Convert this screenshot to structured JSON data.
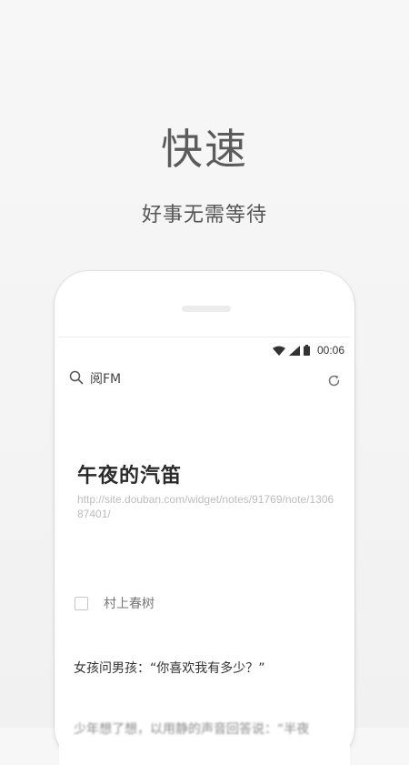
{
  "promo": {
    "headline": "快速",
    "subhead": "好事无需等待"
  },
  "phone": {
    "status_bar": {
      "time": "00:06",
      "icons": [
        "wifi-icon",
        "signal-icon",
        "battery-icon"
      ]
    },
    "search_bar": {
      "text": "阅FM",
      "left_icon": "search-icon",
      "right_icon": "refresh-icon"
    },
    "article": {
      "title": "午夜的汽笛",
      "url": "http://site.douban.com/widget/notes/91769/note/130687401/",
      "author": "村上春树",
      "paragraph1": "女孩问男孩：“你喜欢我有多少？”",
      "paragraph2": "少年想了想，以用静的声音回答说：“半夜"
    }
  },
  "colors": {
    "background": "#f4f4f4",
    "headline": "#5b5b5b",
    "url": "#bdbdbd"
  }
}
